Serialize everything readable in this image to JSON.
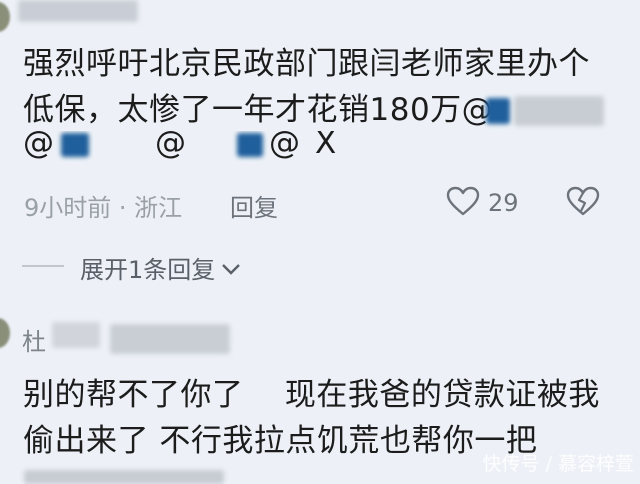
{
  "comment1": {
    "line1": "强烈呼吁北京民政部门跟闫老师家里办个",
    "line2": "低保，太惨了一年才花销180万@",
    "line3_fragments": [
      "@",
      "@",
      "@",
      "X"
    ],
    "time_location": "9小时前 · 浙江",
    "reply_label": "回复",
    "like_count": "29",
    "expand_label": "展开1条回复"
  },
  "comment2": {
    "username_fragment": "杜",
    "line1": "别的帮不了你了    现在我爸的贷款证被我",
    "line2": "偷出来了 不行我拉点饥荒也帮你一把"
  },
  "watermark": "快传号 / 慕容梓萱",
  "colors": {
    "background": "#edf1f7",
    "meta": "#9aa0a8",
    "accent_blur": "#1f5f9c"
  },
  "icons": {
    "like": "heart-outline-icon",
    "dislike": "broken-heart-icon",
    "expand": "chevron-down-icon"
  }
}
